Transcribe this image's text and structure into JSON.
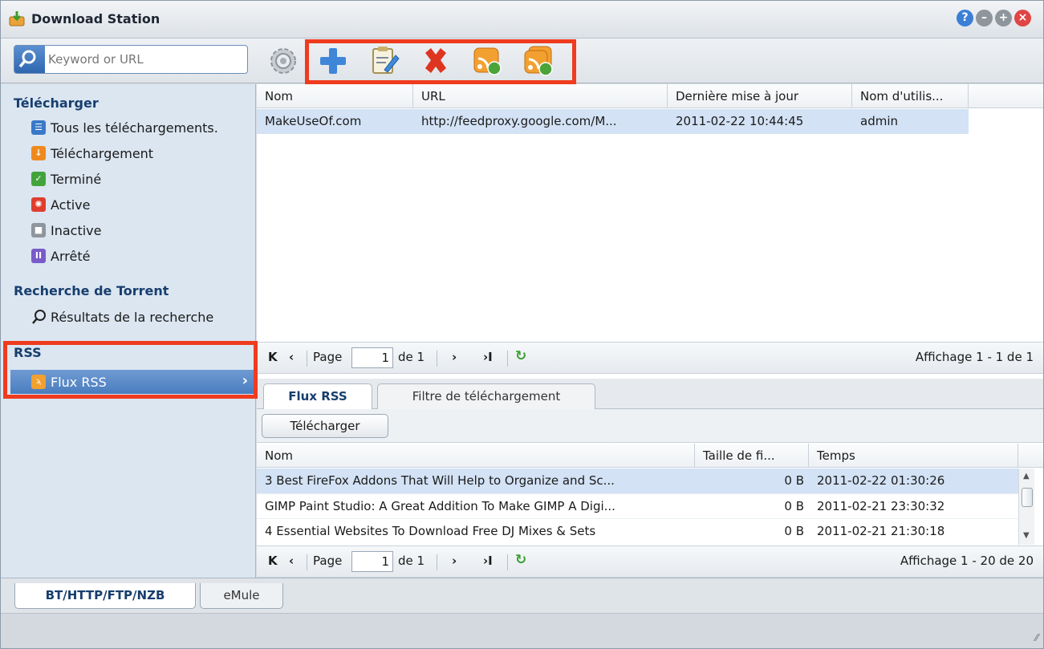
{
  "window": {
    "title": "Download Station"
  },
  "toolbar": {
    "search_placeholder": "Keyword or URL"
  },
  "sidebar": {
    "download_section": "Télécharger",
    "items": [
      "Tous les téléchargements.",
      "Téléchargement",
      "Terminé",
      "Active",
      "Inactive",
      "Arrêté"
    ],
    "torrent_section": "Recherche de Torrent",
    "search_results": "Résultats de la recherche",
    "rss_section": "RSS",
    "rss_feed": "Flux RSS"
  },
  "feeds": {
    "columns": [
      "Nom",
      "URL",
      "Dernière mise à jour",
      "Nom d'utilis..."
    ],
    "rows": [
      {
        "name": "MakeUseOf.com",
        "url": "http://feedproxy.google.com/M...",
        "updated": "2011-02-22 10:44:45",
        "user": "admin"
      }
    ]
  },
  "pager_top": {
    "page_label": "Page",
    "page": "1",
    "of": "de 1",
    "display": "Affichage 1 - 1 de 1"
  },
  "tabs": {
    "rss": "Flux RSS",
    "filter": "Filtre de téléchargement"
  },
  "download_button": "Télécharger",
  "items": {
    "columns": [
      "Nom",
      "Taille de fi...",
      "Temps"
    ],
    "rows": [
      {
        "name": "3 Best FireFox Addons That Will Help to Organize and Sc...",
        "size": "0 B",
        "time": "2011-02-22 01:30:26"
      },
      {
        "name": "GIMP Paint Studio: A Great Addition To Make GIMP A Digi...",
        "size": "0 B",
        "time": "2011-02-21 23:30:32"
      },
      {
        "name": "4 Essential Websites To Download Free DJ Mixes & Sets",
        "size": "0 B",
        "time": "2011-02-21 21:30:18"
      }
    ]
  },
  "pager_bottom": {
    "page_label": "Page",
    "page": "1",
    "of": "de 1",
    "display": "Affichage 1 - 20 de 20"
  },
  "bottom_tabs": {
    "bt": "BT/HTTP/FTP/NZB",
    "emule": "eMule"
  },
  "colors": {
    "highlight": "#ef3b1e",
    "selected_nav": "#4a7dbf",
    "selected_row": "#d3e2f5"
  }
}
